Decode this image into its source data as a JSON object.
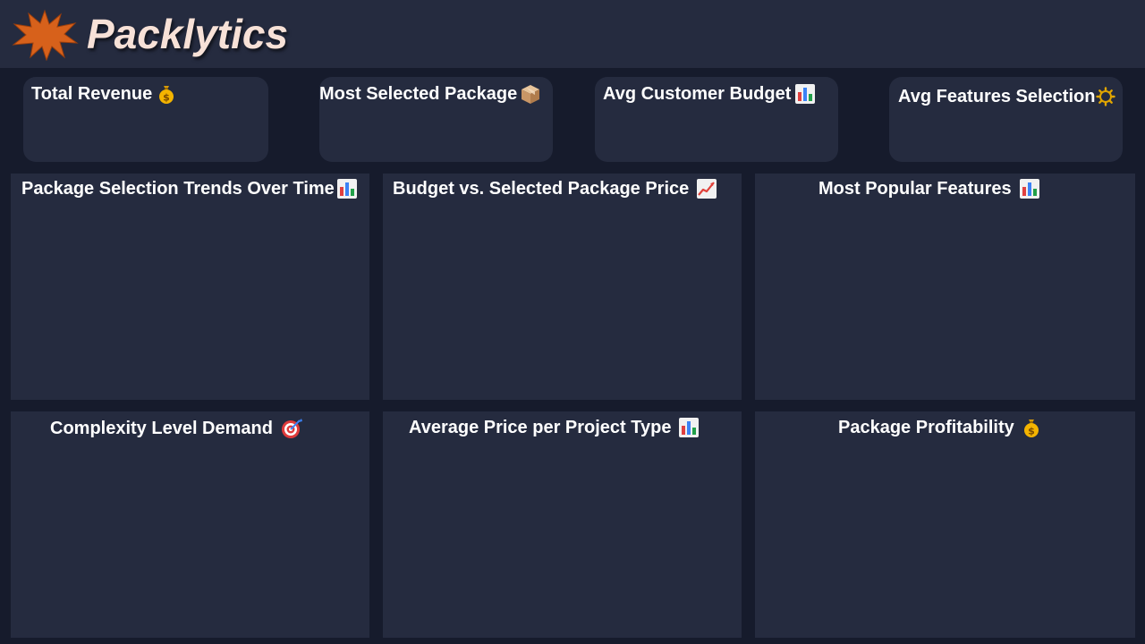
{
  "app": {
    "brand": "Packlytics",
    "logo_icon": "starburst-icon",
    "accent_color": "#d7611b"
  },
  "kpis": [
    {
      "title": "Total Revenue",
      "icon": "money-bag-icon"
    },
    {
      "title": "Most Selected Package",
      "icon": "package-box-icon"
    },
    {
      "title": "Avg Customer Budget",
      "icon": "bar-chart-icon"
    },
    {
      "title": "Avg Features Selection",
      "icon": "gear-icon"
    }
  ],
  "panels": [
    {
      "title": "Package Selection Trends Over Time",
      "icon": "bar-chart-icon"
    },
    {
      "title": "Budget vs. Selected Package Price",
      "icon": "trending-up-icon"
    },
    {
      "title": "Most Popular Features",
      "icon": "bar-chart-icon"
    },
    {
      "title": "Complexity Level Demand",
      "icon": "target-icon"
    },
    {
      "title": "Average Price per Project Type",
      "icon": "bar-chart-icon"
    },
    {
      "title": "Package Profitability",
      "icon": "money-bag-icon"
    }
  ],
  "colors": {
    "background": "#161b2c",
    "card": "#252b3f",
    "brand_text": "#f7e1d7"
  }
}
